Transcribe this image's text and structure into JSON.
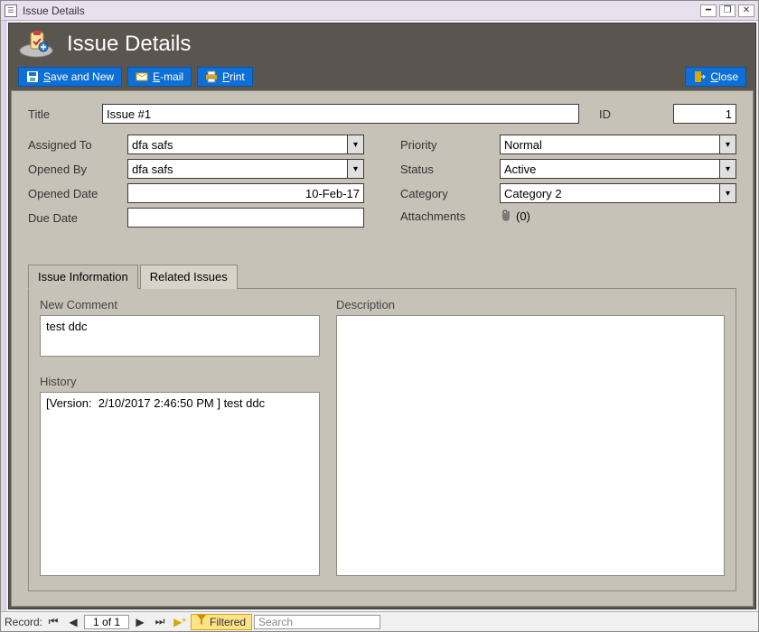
{
  "window": {
    "title": "Issue Details"
  },
  "header": {
    "title": "Issue Details"
  },
  "toolbar": {
    "save_new": "ave and New",
    "save_new_hk": "S",
    "email": "-mail",
    "email_hk": "E",
    "print": "rint",
    "print_hk": "P",
    "close": "lose",
    "close_hk": "C"
  },
  "fields": {
    "title_label": "Title",
    "title_value": "Issue #1",
    "id_label": "ID",
    "id_value": "1",
    "assigned_to_label": "Assigned To",
    "assigned_to_value": "dfa safs",
    "opened_by_label": "Opened By",
    "opened_by_value": "dfa safs",
    "opened_date_label": "Opened Date",
    "opened_date_value": "10-Feb-17",
    "due_date_label": "Due Date",
    "due_date_value": "",
    "priority_label": "Priority",
    "priority_value": "Normal",
    "status_label": "Status",
    "status_value": "Active",
    "category_label": "Category",
    "category_value": "Category 2",
    "attachments_label": "Attachments",
    "attachments_count": "(0)"
  },
  "tabs": {
    "t1": "Issue Information",
    "t2": "Related Issues",
    "new_comment_label": "New Comment",
    "new_comment_value": "test ddc",
    "history_label": "History",
    "history_value": "[Version:  2/10/2017 2:46:50 PM ] test ddc",
    "description_label": "Description",
    "description_value": ""
  },
  "recnav": {
    "label": "Record:",
    "pos": "1 of 1",
    "filtered": "Filtered",
    "search_placeholder": "Search"
  }
}
